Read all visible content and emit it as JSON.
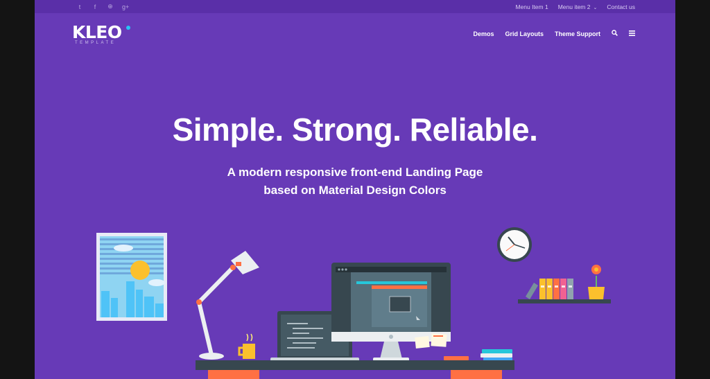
{
  "topbar": {
    "social_icons": [
      "twitter-icon",
      "facebook-icon",
      "dribbble-icon",
      "google-plus-icon"
    ],
    "social_glyphs": [
      "t",
      "f",
      "⊕",
      "g+"
    ],
    "menu": [
      {
        "label": "Menu Item 1"
      },
      {
        "label": "Menu item 2",
        "has_dropdown": true
      },
      {
        "label": "Contact us"
      }
    ]
  },
  "logo": {
    "brand": "KLEO",
    "tagline": "TEMPLATE"
  },
  "nav": {
    "items": [
      {
        "label": "Demos"
      },
      {
        "label": "Grid Layouts"
      },
      {
        "label": "Theme Support"
      }
    ],
    "search_icon": "search-icon",
    "menu_icon": "hamburger-menu-icon"
  },
  "hero": {
    "title": "Simple. Strong. Reliable.",
    "subtitle_line1": "A modern responsive front-end Landing Page",
    "subtitle_line2": "based on Material Design Colors"
  },
  "colors": {
    "background": "#673ab7",
    "topbar": "#5a2fa8",
    "page_surround": "#141414",
    "accent": "#27c4f5"
  }
}
